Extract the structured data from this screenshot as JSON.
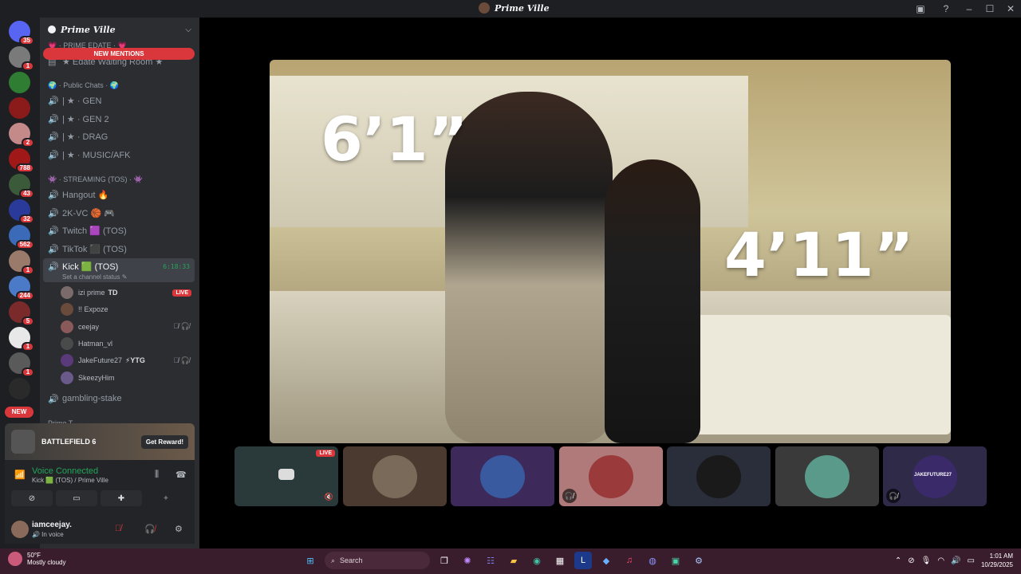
{
  "window": {
    "title": "Prime Ville",
    "inbox_icon": "inbox-icon",
    "help_icon": "help-icon",
    "minimize": "–",
    "maximize": "☐",
    "close": "✕"
  },
  "servers": [
    {
      "badge": "35",
      "color": "#5865f2"
    },
    {
      "badge": "1",
      "color": "#7a7a7a"
    },
    {
      "badge": "",
      "color": "#2e7d32"
    },
    {
      "badge": "",
      "color": "#8b1a1a"
    },
    {
      "badge": "2",
      "color": "#c48a8a"
    },
    {
      "badge": "788",
      "color": "#a01818"
    },
    {
      "badge": "43",
      "color": "#3a5a3a"
    },
    {
      "badge": "32",
      "color": "#2a3a9a"
    },
    {
      "badge": "562",
      "color": "#3a6ab8"
    },
    {
      "badge": "1",
      "color": "#9a7a6a"
    },
    {
      "badge": "244",
      "color": "#4a7ac8"
    },
    {
      "badge": "5",
      "color": "#7a2a2a"
    },
    {
      "badge": "1",
      "color": "#e8e8e8"
    },
    {
      "badge": "1",
      "color": "#5a5a5a"
    },
    {
      "badge": "",
      "color": "#2a2a2a"
    }
  ],
  "servers_new_label": "NEW",
  "guild": {
    "name": "Prime Ville",
    "new_mentions": "NEW MENTIONS",
    "top_category": "💗 · PRIME EDATE · 💗",
    "top_channel": "★ Edate Waiting Room ★",
    "public_category": "🌍 · Public Chats · 🌍",
    "public_channels": [
      "| ★ · GEN",
      "| ★ · GEN 2",
      "| ★ · DRAG",
      "| ★ · MUSIC/AFK"
    ],
    "streaming_category": "👾 · STREAMING (TOS) · 👾",
    "streaming_channels": [
      "Hangout 🔥",
      "2K-VC 🏀 🎮",
      "Twitch 🟪 (TOS)",
      "TikTok ⬛ (TOS)"
    ],
    "active_channel": {
      "name": "Kick 🟩 (TOS)",
      "timer": "6:18:33",
      "status": "Set a channel status ✎"
    },
    "voice_users": [
      {
        "name": "izi prime",
        "tag": "TD",
        "live": "LIVE",
        "muted": "",
        "color": "#7a6a6a"
      },
      {
        "name": "!! Expoze",
        "tag": "",
        "live": "",
        "muted": "",
        "color": "#6a4a3a"
      },
      {
        "name": "ceejay",
        "tag": "",
        "live": "",
        "muted": "🎙̸ 🎧̸",
        "color": "#8a5a5a"
      },
      {
        "name": "Hatman_vl",
        "tag": "",
        "live": "",
        "muted": "",
        "color": "#4a4a4a"
      },
      {
        "name": "JakeFuture27",
        "tag": "⚡YTG",
        "live": "",
        "muted": "🎙̸ 🎧̸",
        "color": "#5a3a7a"
      },
      {
        "name": "SkeezyHim",
        "tag": "",
        "live": "",
        "muted": "",
        "color": "#6a5a8a"
      }
    ],
    "after_channel": "gambling-stake",
    "peek_category": "Prime T..."
  },
  "promo": {
    "title": "BATTLEFIELD 6",
    "button": "Get Reward!"
  },
  "voice": {
    "status": "Voice Connected",
    "sub": "Kick 🟩 (TOS) / Prime Ville"
  },
  "user": {
    "name": "iamceejay.",
    "status": "🔊 In voice"
  },
  "main_video": {
    "label_a": "6’1”",
    "label_b": "4’11”"
  },
  "tiles": [
    {
      "bg": "#2a3a3a",
      "av": "#dcdcdc",
      "live": "LIVE",
      "mute": "",
      "vol": "🔇"
    },
    {
      "bg": "#4a3a30",
      "av": "#7a6a5a",
      "live": "",
      "mute": "",
      "vol": ""
    },
    {
      "bg": "#3e2a5a",
      "av": "#3a5aa0",
      "live": "",
      "mute": "",
      "vol": ""
    },
    {
      "bg": "#b07a7a",
      "av": "#9a3a3a",
      "live": "",
      "mute": "🎧̸",
      "vol": ""
    },
    {
      "bg": "#2a2e3a",
      "av": "#1a1a1a",
      "live": "",
      "mute": "",
      "vol": ""
    },
    {
      "bg": "#3a3a3a",
      "av": "#5a9a8a",
      "live": "",
      "mute": "",
      "vol": ""
    },
    {
      "bg": "#2e2a48",
      "av": "#3a2a6a",
      "live": "",
      "mute": "🎧̸",
      "vol": ""
    }
  ],
  "tile_center_label": "JAKEFUTURE27",
  "taskbar": {
    "temp": "50°F",
    "weather": "Mostly cloudy",
    "search": "Search",
    "time": "1:01 AM",
    "date": "10/29/2025"
  }
}
